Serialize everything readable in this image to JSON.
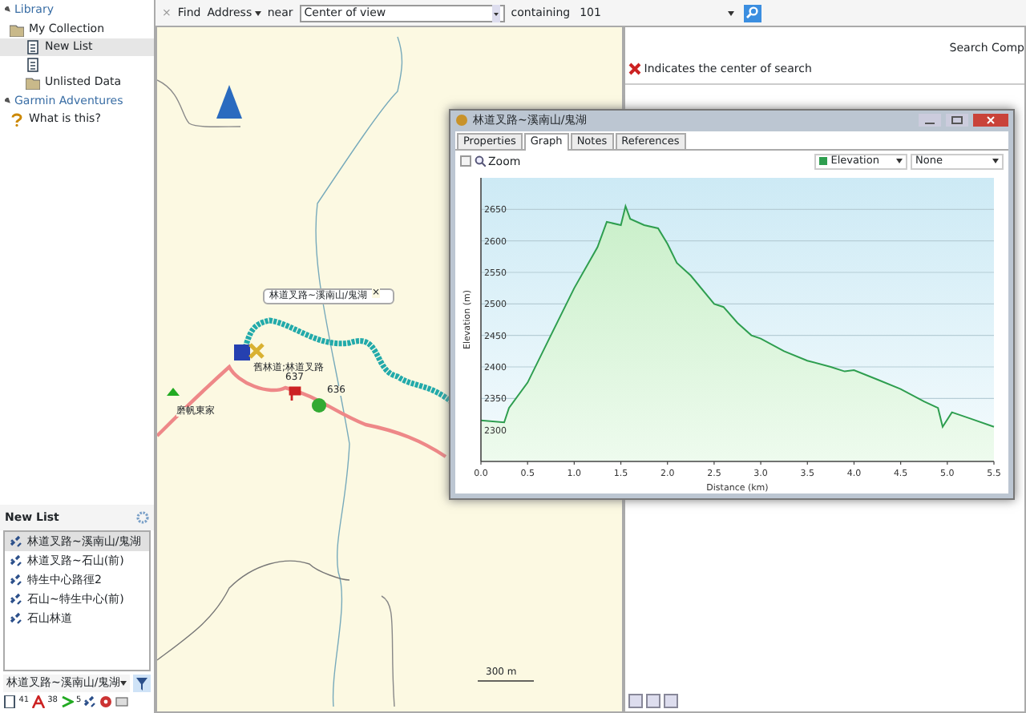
{
  "library": {
    "title": "Library",
    "items": [
      {
        "label": "My Collection",
        "kind": "folder",
        "selected": false,
        "children": [
          {
            "label": "New List",
            "kind": "list",
            "selected": true
          },
          {
            "kind": "list",
            "selected": false
          },
          {
            "label": "Unlisted Data",
            "kind": "folder",
            "selected": false
          }
        ]
      }
    ]
  },
  "adventures": {
    "title": "Garmin Adventures",
    "items": [
      {
        "label": "What is this?",
        "kind": "help",
        "selected": false
      }
    ]
  },
  "list_panel": {
    "title": "New List",
    "items": [
      {
        "label": "林道叉路~溪南山/鬼湖",
        "selected": true
      },
      {
        "label": "林道叉路~石山(前)",
        "selected": false
      },
      {
        "label": "特生中心路徑2",
        "selected": false
      },
      {
        "label": "石山~特生中心(前)",
        "selected": false
      },
      {
        "label": "石山林道",
        "selected": false
      }
    ],
    "filter": {
      "value": "林道叉路~溪南山/鬼湖"
    },
    "counts": [
      "41",
      "38",
      "5"
    ]
  },
  "find_bar": {
    "close": "×",
    "find": "Find",
    "type": "Address",
    "near": "near",
    "near_value": "Center of view",
    "containing": "containing",
    "query": "101"
  },
  "map": {
    "labels": [
      "林道叉路~溪南山/鬼湖",
      "×",
      "舊林道;林道叉路",
      "磨帆東家",
      "637",
      "636",
      "300 m"
    ]
  },
  "search_panel": {
    "title": "Search Comp",
    "legend": "Indicates the center of search"
  },
  "track_window": {
    "title": "林道叉路~溪南山/鬼湖",
    "tabs": [
      {
        "label": "Properties",
        "selected": false
      },
      {
        "label": "Graph",
        "selected": true
      },
      {
        "label": "Notes",
        "selected": false
      },
      {
        "label": "References",
        "selected": false
      }
    ],
    "zoom": {
      "label": "Zoom",
      "checked": false
    },
    "secondary": "None",
    "chart_data": {
      "type": "area",
      "xlabel": "Distance (km)",
      "ylabel": "Elevation (m)",
      "xlim": [
        0,
        5.5
      ],
      "ylim": [
        2250,
        2700
      ],
      "grid": true,
      "xticks": [
        {
          "value": 0,
          "label": "0.0"
        },
        0.5,
        {
          "value": 1,
          "label": "1.0"
        },
        1.5,
        {
          "value": 2,
          "label": "2.0"
        },
        2.5,
        {
          "value": 3,
          "label": "3.0"
        },
        3.5,
        {
          "value": 4,
          "label": "4.0"
        },
        4.5,
        {
          "value": 5,
          "label": "5.0"
        },
        5.5
      ],
      "yticks": [
        2300,
        2350,
        2400,
        2450,
        2500,
        2550,
        2600,
        2650
      ],
      "x": [
        0,
        0.25,
        0.3,
        0.5,
        0.75,
        1,
        1.25,
        1.35,
        1.5,
        1.55,
        1.6,
        1.75,
        1.9,
        2,
        2.1,
        2.25,
        2.5,
        2.6,
        2.75,
        2.9,
        3,
        3.25,
        3.5,
        3.75,
        3.9,
        4,
        4.25,
        4.5,
        4.75,
        4.9,
        4.95,
        5.05,
        5.25,
        5.5
      ],
      "series": [
        {
          "name": "Elevation",
          "color": "#2e9e4f",
          "values": [
            2315,
            2312,
            2335,
            2375,
            2450,
            2525,
            2590,
            2630,
            2625,
            2655,
            2635,
            2625,
            2620,
            2595,
            2565,
            2545,
            2500,
            2495,
            2470,
            2450,
            2445,
            2425,
            2410,
            2400,
            2393,
            2395,
            2380,
            2365,
            2345,
            2335,
            2305,
            2328,
            2318,
            2305
          ]
        }
      ]
    }
  }
}
